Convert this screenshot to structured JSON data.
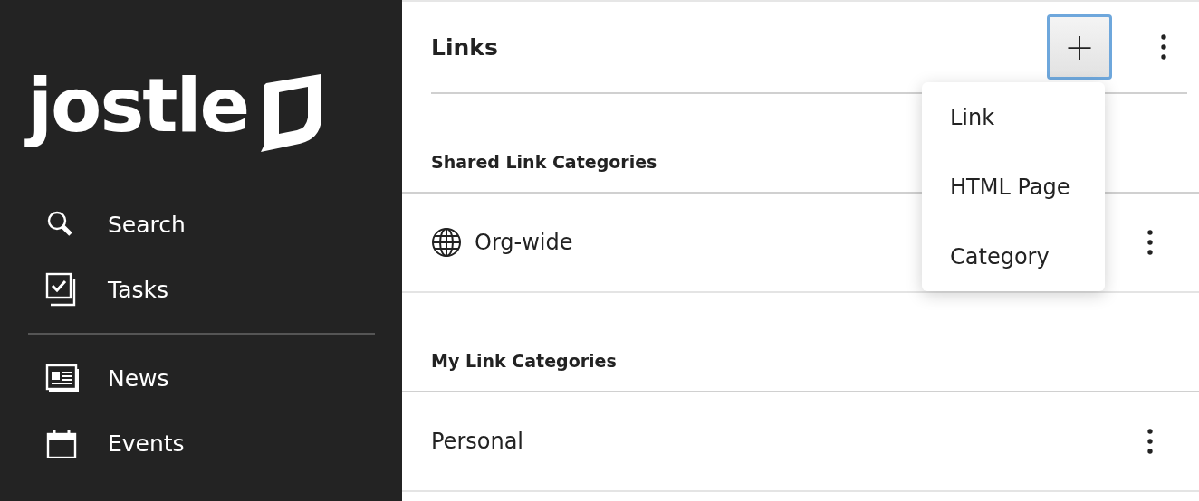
{
  "sidebar": {
    "logo": "jostle",
    "items": [
      {
        "label": "Search",
        "kind": "search"
      },
      {
        "label": "Tasks",
        "kind": "tasks"
      },
      {
        "kind": "divider"
      },
      {
        "label": "News",
        "kind": "news"
      },
      {
        "label": "Events",
        "kind": "events"
      }
    ]
  },
  "header": {
    "title": "Links",
    "add_button": {
      "label": "+",
      "expanded": true
    }
  },
  "sections": [
    {
      "heading": "Shared Link Categories",
      "rows": [
        {
          "label": "Org-wide",
          "kind": "globe"
        }
      ]
    },
    {
      "heading": "My Link Categories",
      "rows": [
        {
          "label": "Personal",
          "kind": "plain"
        }
      ]
    }
  ],
  "add_menu": {
    "items": [
      "Link",
      "HTML Page",
      "Category"
    ]
  }
}
